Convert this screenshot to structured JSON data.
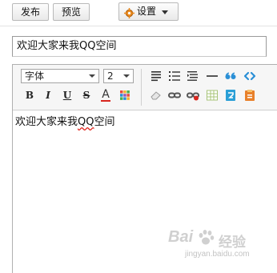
{
  "top_bar": {
    "publish_label": "发布",
    "preview_label": "预览",
    "settings_label": "设置"
  },
  "title_field": {
    "value": "欢迎大家来我QQ空间"
  },
  "toolbar": {
    "font_select_value": "字体",
    "size_select_value": "2",
    "row1_icons": [
      "align-left-icon",
      "ordered-list-icon",
      "unordered-list-icon",
      "horizontal-rule-icon",
      "quote-icon",
      "code-icon"
    ],
    "row2_icons": [
      "bold-icon",
      "italic-icon",
      "underline-icon",
      "strikethrough-icon",
      "font-color-icon",
      "background-color-icon",
      "eraser-icon",
      "link-icon",
      "unlink-icon",
      "table-icon",
      "image-icon",
      "paste-icon"
    ],
    "bold_label": "B",
    "italic_label": "I",
    "underline_label": "U",
    "strike_label": "S",
    "font_color_label": "A",
    "font_color": "#d8261e"
  },
  "editor": {
    "text_before": "欢迎大家来我",
    "text_flagged": "QQ",
    "text_after": "空间"
  },
  "watermark": {
    "brand": "Bai",
    "brand2": "经验",
    "url": "jingyan.baidu.com"
  }
}
